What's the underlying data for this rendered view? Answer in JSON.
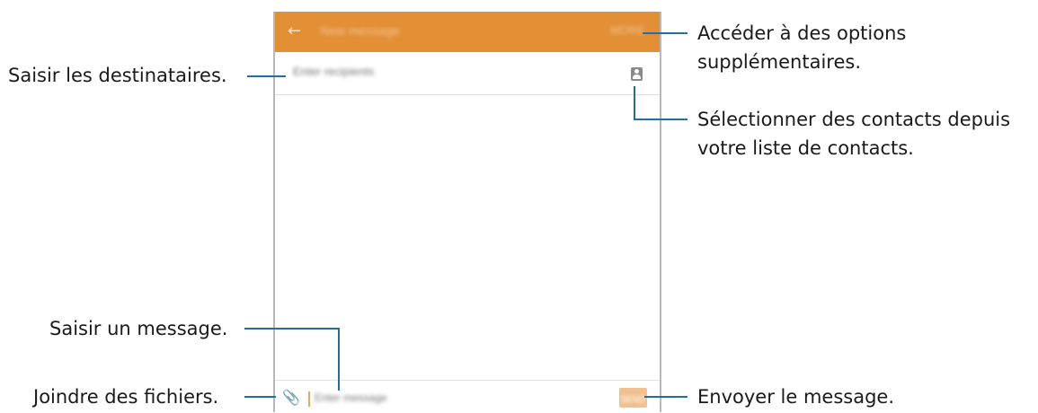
{
  "app": {
    "title": "New message",
    "more_label": "MORE",
    "recipient_placeholder": "Enter recipients",
    "message_placeholder": "Enter message",
    "send_label": "SEND",
    "accent_color": "#e28f36"
  },
  "annotations": {
    "recipients": "Saisir les destinataires.",
    "options_line1": "Accéder à des options",
    "options_line2": "supplémentaires.",
    "contacts_line1": "Sélectionner des contacts depuis",
    "contacts_line2": "votre liste de contacts.",
    "message": "Saisir un message.",
    "attach": "Joindre des fichiers.",
    "send": "Envoyer le message."
  },
  "icons": {
    "back": "back-arrow-icon",
    "contacts": "contact-card-icon",
    "attach": "paperclip-icon"
  }
}
